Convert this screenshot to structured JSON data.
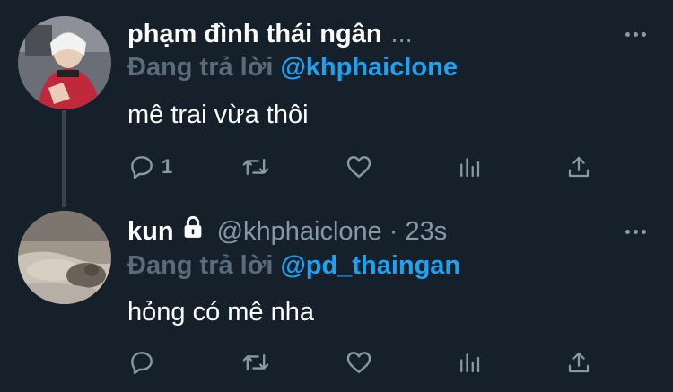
{
  "tweets": [
    {
      "display_name": "phạm đình thái ngân",
      "handle": "",
      "timestamp": "",
      "truncation": "...",
      "locked": false,
      "replying_prefix": "Đang trả lời",
      "replying_to": "@khphaiclone",
      "text": "mê trai vừa thôi",
      "reply_count": "1",
      "retweet_count": "",
      "like_count": ""
    },
    {
      "display_name": "kun",
      "handle": "@khphaiclone",
      "timestamp": "· 23s",
      "truncation": "",
      "locked": true,
      "replying_prefix": "Đang trả lời",
      "replying_to": "@pd_thaingan",
      "text": "hỏng có mê nha",
      "reply_count": "",
      "retweet_count": "",
      "like_count": ""
    }
  ],
  "icons": {
    "reply": "reply-icon",
    "retweet": "retweet-icon",
    "like": "heart-icon",
    "analytics": "analytics-icon",
    "share": "share-icon",
    "more": "more-icon",
    "lock": "lock-icon"
  },
  "colors": {
    "background": "#15202b",
    "text": "#ffffff",
    "secondary": "#8899a6",
    "link": "#1da1f2",
    "thread_line": "#38444d"
  }
}
